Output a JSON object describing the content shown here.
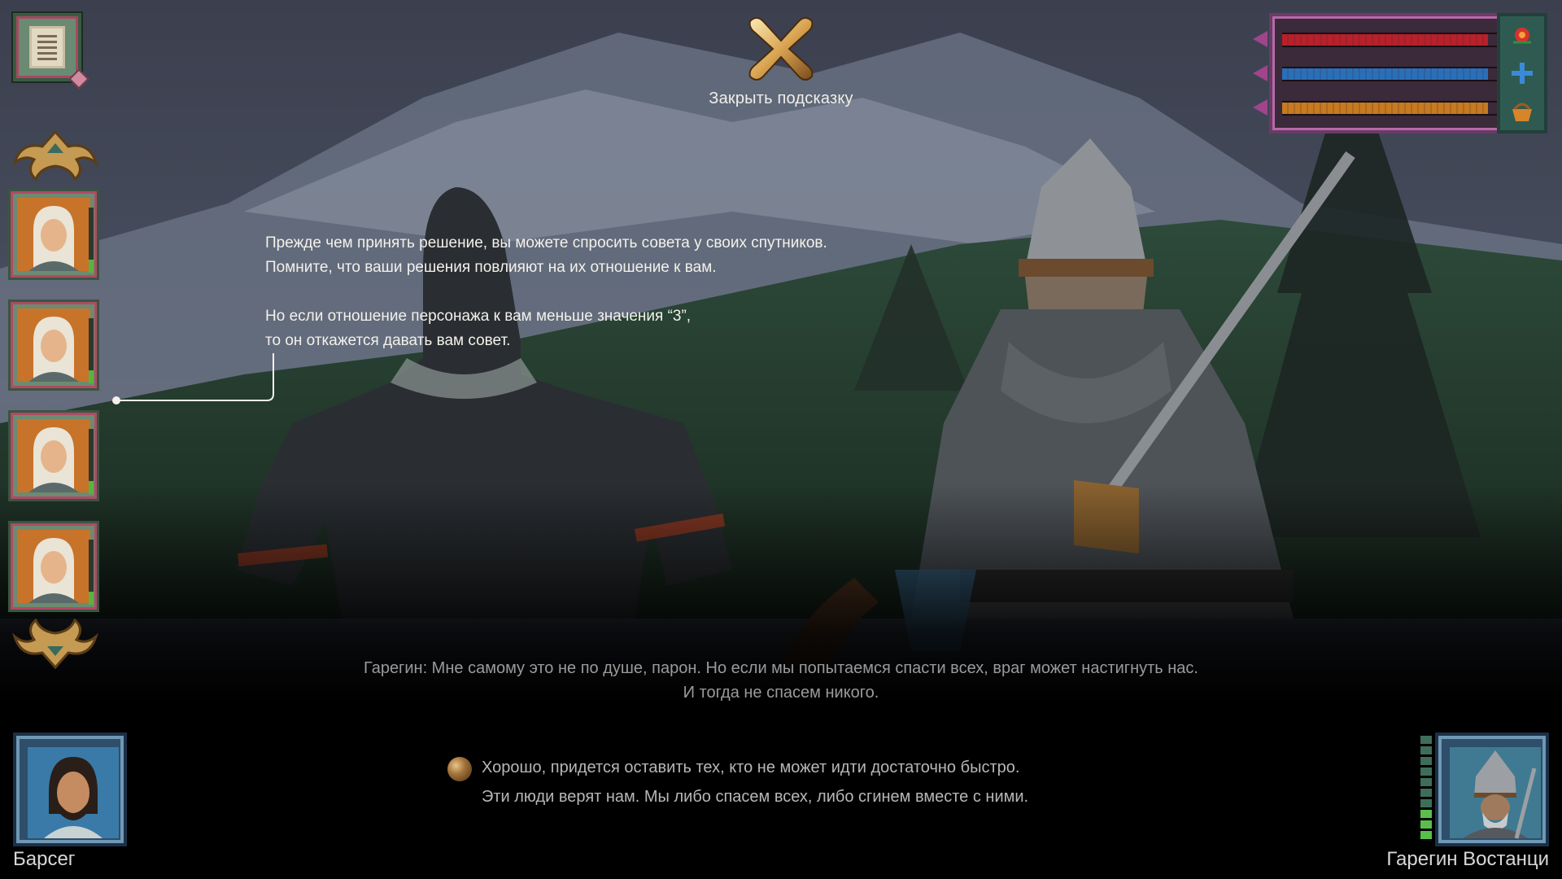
{
  "close_hint": {
    "label": "Закрыть подсказку"
  },
  "status": {
    "bars": [
      {
        "name": "health",
        "color": "#b8202a",
        "fill": 0.95
      },
      {
        "name": "faith",
        "color": "#2a6fb8",
        "fill": 0.95
      },
      {
        "name": "supplies",
        "color": "#c77a1e",
        "fill": 0.95
      }
    ],
    "icons": [
      "rose-icon",
      "cross-icon",
      "basket-icon"
    ]
  },
  "companions": [
    {
      "relation_level": 0.2
    },
    {
      "relation_level": 0.2
    },
    {
      "relation_level": 0.2
    },
    {
      "relation_level": 0.2
    }
  ],
  "hint": {
    "paragraph1_line1": "Прежде чем принять решение, вы можете спросить совета у своих спутников.",
    "paragraph1_line2": "Помните, что ваши решения повлияют на их отношение к вам.",
    "paragraph2_line1": "Но если отношение персонажа к вам меньше значения “3”,",
    "paragraph2_line2": "то он откажется давать вам совет."
  },
  "dialogue": {
    "npc_line1": "Гарегин: Мне самому это не по душе, парон. Но если мы попытаемся спасти всех, враг может настигнуть нас.",
    "npc_line2": "И тогда не спасем никого.",
    "choice1": "Хорошо, придется оставить тех, кто не может идти достаточно быстро.",
    "choice2": "Эти люди верят нам. Мы либо спасем всех, либо сгинем вместе с ними."
  },
  "player": {
    "name": "Барсег"
  },
  "npc": {
    "name": "Гарегин Востанци",
    "relation_level": 0.3
  },
  "colors": {
    "hint_text": "#f3f1ea",
    "dialogue_text": "#9a9a9a",
    "choice_text": "#b7b7b7"
  }
}
